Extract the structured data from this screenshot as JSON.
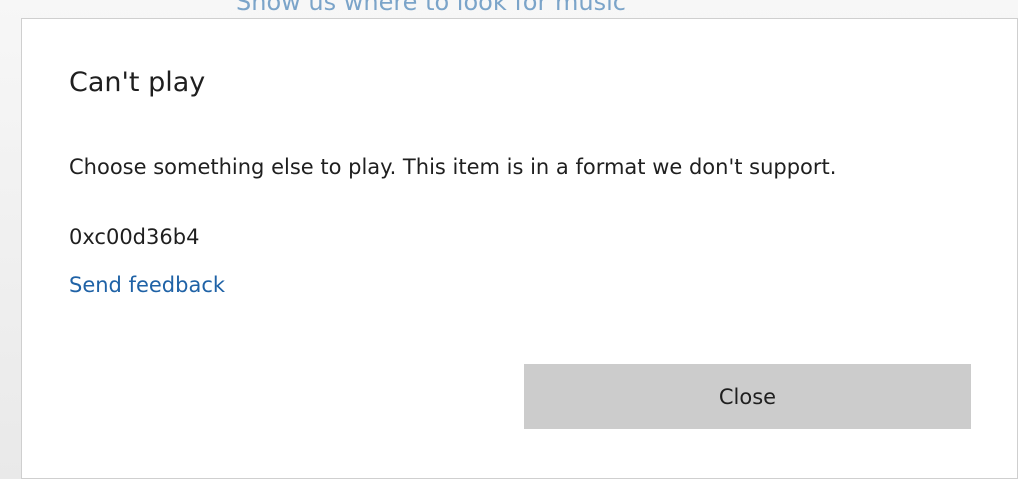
{
  "background": {
    "partial_link_text": "Show us where to look for music"
  },
  "dialog": {
    "title": "Can't play",
    "message": "Choose something else to play. This item is in a format we don't support.",
    "error_code": "0xc00d36b4",
    "feedback_link": "Send feedback",
    "close_label": "Close"
  },
  "colors": {
    "link": "#1f62a6",
    "button_bg": "#cccccc",
    "text": "#1f1f1f",
    "dialog_bg": "#ffffff"
  }
}
